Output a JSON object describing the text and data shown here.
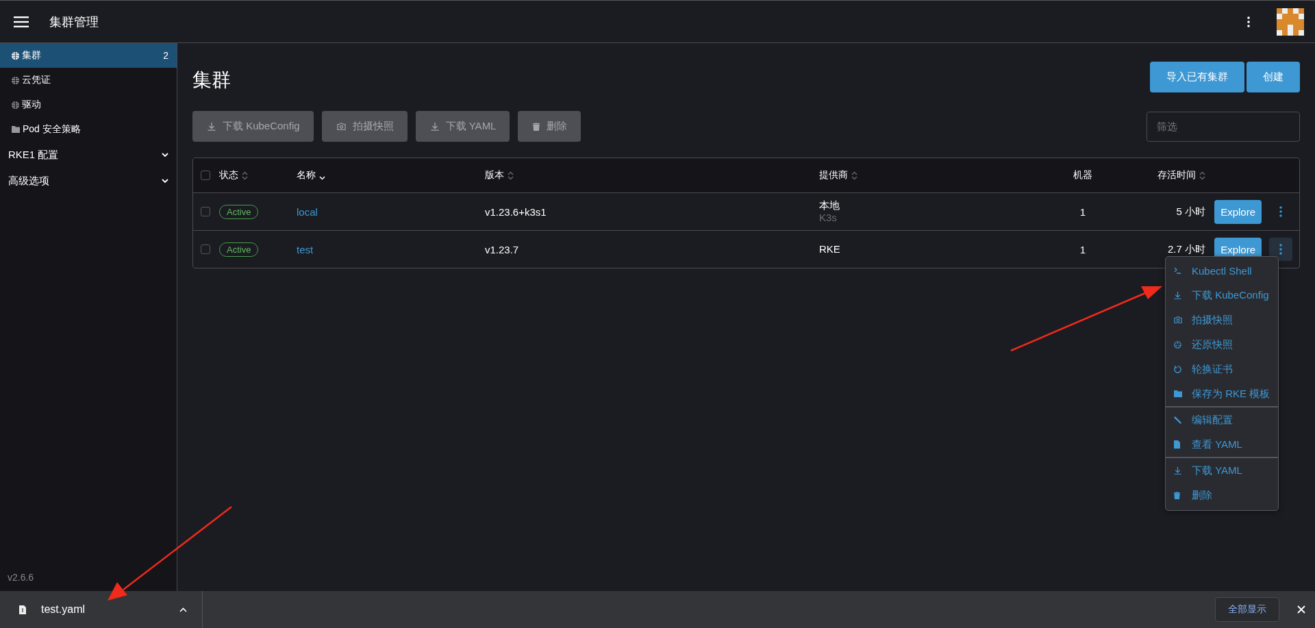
{
  "header": {
    "title": "集群管理"
  },
  "sidebar": {
    "items": [
      {
        "kind": "globe",
        "label": "集群",
        "count": "2",
        "selected": true
      },
      {
        "kind": "globe",
        "label": "云凭证",
        "selected": false
      },
      {
        "kind": "globe",
        "label": "驱动",
        "selected": false
      },
      {
        "kind": "folder",
        "label": "Pod 安全策略",
        "selected": false
      },
      {
        "kind": "group",
        "label": "RKE1 配置",
        "expanded": false
      },
      {
        "kind": "group",
        "label": "高级选项",
        "expanded": false
      }
    ],
    "version": "v2.6.6"
  },
  "page": {
    "title": "集群",
    "actions": [
      "导入已有集群",
      "创建"
    ],
    "bulk_actions": [
      {
        "kind": "download",
        "label": "下载 KubeConfig",
        "disabled": true
      },
      {
        "kind": "camera",
        "label": "拍摄快照",
        "disabled": true
      },
      {
        "kind": "download",
        "label": "下载 YAML",
        "disabled": true
      },
      {
        "kind": "trash",
        "label": "删除",
        "disabled": true
      }
    ],
    "filter": {
      "placeholder": "筛选"
    }
  },
  "table": {
    "all_checked": false,
    "columns": [
      {
        "label": "状态",
        "sortable": true,
        "sorted": false
      },
      {
        "label": "名称",
        "sortable": true,
        "sorted": true
      },
      {
        "label": "版本",
        "sortable": true,
        "sorted": false
      },
      {
        "label": "提供商",
        "sortable": true,
        "sorted": false
      },
      {
        "label": "机器",
        "sortable": false
      },
      {
        "label": "存活时间",
        "sortable": true,
        "sorted": false
      }
    ],
    "rows": [
      {
        "checked": false,
        "status": "Active",
        "name": "local",
        "version": "v1.23.6+k3s1",
        "provider": "本地",
        "provider_detail": "K3s",
        "machines": "1",
        "age": "5 小时",
        "explore": "Explore",
        "menu_open": false
      },
      {
        "checked": false,
        "status": "Active",
        "name": "test",
        "version": "v1.23.7",
        "provider": "RKE",
        "machines": "1",
        "age": "2.7 小时",
        "explore": "Explore",
        "menu_open": true
      }
    ]
  },
  "menu": {
    "groups": [
      [
        {
          "kind": "terminal",
          "label": "Kubectl Shell"
        },
        {
          "kind": "download",
          "label": "下载 KubeConfig"
        },
        {
          "kind": "camera",
          "label": "拍摄快照"
        },
        {
          "kind": "restore",
          "label": "还原快照"
        },
        {
          "kind": "rotate",
          "label": "轮换证书"
        },
        {
          "kind": "folder",
          "label": "保存为 RKE 模板"
        }
      ],
      [
        {
          "kind": "edit",
          "label": "编辑配置"
        },
        {
          "kind": "file",
          "label": "查看 YAML"
        }
      ],
      [
        {
          "kind": "download",
          "label": "下载 YAML"
        },
        {
          "kind": "trash",
          "label": "删除"
        }
      ]
    ]
  },
  "downloads": {
    "file": "test.yaml",
    "show_all": "全部显示"
  }
}
